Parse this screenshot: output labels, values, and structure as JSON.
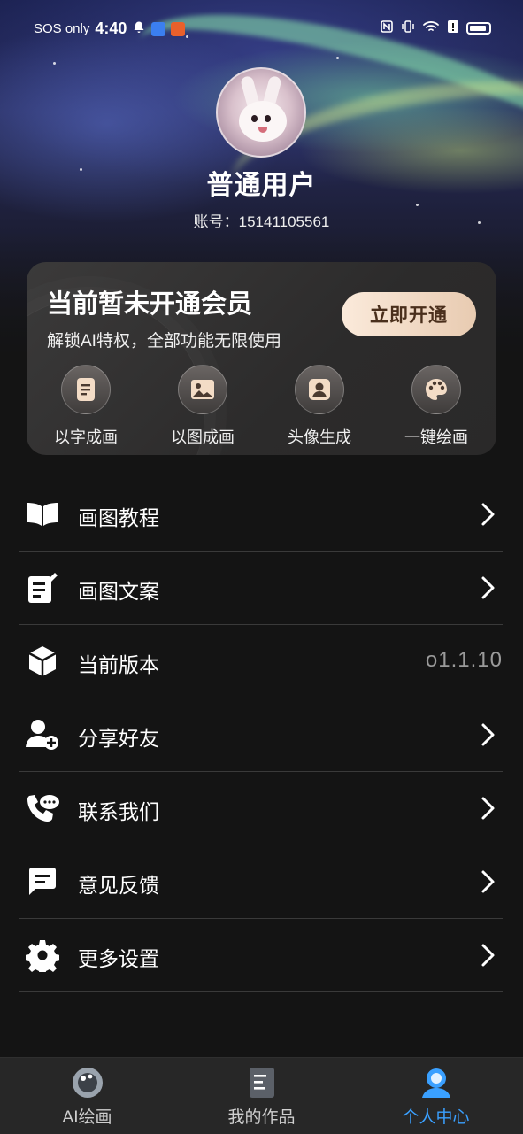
{
  "status_bar": {
    "carrier": "SOS only",
    "time": "4:40",
    "icons_left": [
      "bell-icon",
      "app-badge-icon",
      "app-badge-icon"
    ],
    "icons_right": [
      "nfc-icon",
      "vibrate-icon",
      "wifi-icon",
      "alert-icon",
      "battery-icon"
    ]
  },
  "profile": {
    "username": "普通用户",
    "account": "账号：15141105561"
  },
  "vip": {
    "title": "当前暂未开通会员",
    "subtitle": "解锁AI特权，全部功能无限使用",
    "button": "立即开通",
    "features": [
      {
        "label": "以字成画",
        "icon": "document-icon"
      },
      {
        "label": "以图成画",
        "icon": "image-icon"
      },
      {
        "label": "头像生成",
        "icon": "person-icon"
      },
      {
        "label": "一键绘画",
        "icon": "palette-icon"
      }
    ]
  },
  "menu": [
    {
      "label": "画图教程",
      "icon": "book-icon",
      "trailing": "chevron"
    },
    {
      "label": "画图文案",
      "icon": "edit-note-icon",
      "trailing": "chevron"
    },
    {
      "label": "当前版本",
      "icon": "cube-icon",
      "value": "o1.1.10"
    },
    {
      "label": "分享好友",
      "icon": "add-user-icon",
      "trailing": "chevron"
    },
    {
      "label": "联系我们",
      "icon": "phone-chat-icon",
      "trailing": "chevron"
    },
    {
      "label": "意见反馈",
      "icon": "feedback-icon",
      "trailing": "chevron"
    },
    {
      "label": "更多设置",
      "icon": "gear-icon",
      "trailing": "chevron"
    }
  ],
  "tabs": [
    {
      "label": "AI绘画",
      "icon": "palette-tab-icon",
      "active": false
    },
    {
      "label": "我的作品",
      "icon": "works-tab-icon",
      "active": false
    },
    {
      "label": "个人中心",
      "icon": "profile-tab-icon",
      "active": true
    }
  ],
  "colors": {
    "background": "#141414",
    "accent": "#3aa0ff",
    "vip_button": "#f3dcc6",
    "divider": "#3a3a3a"
  }
}
